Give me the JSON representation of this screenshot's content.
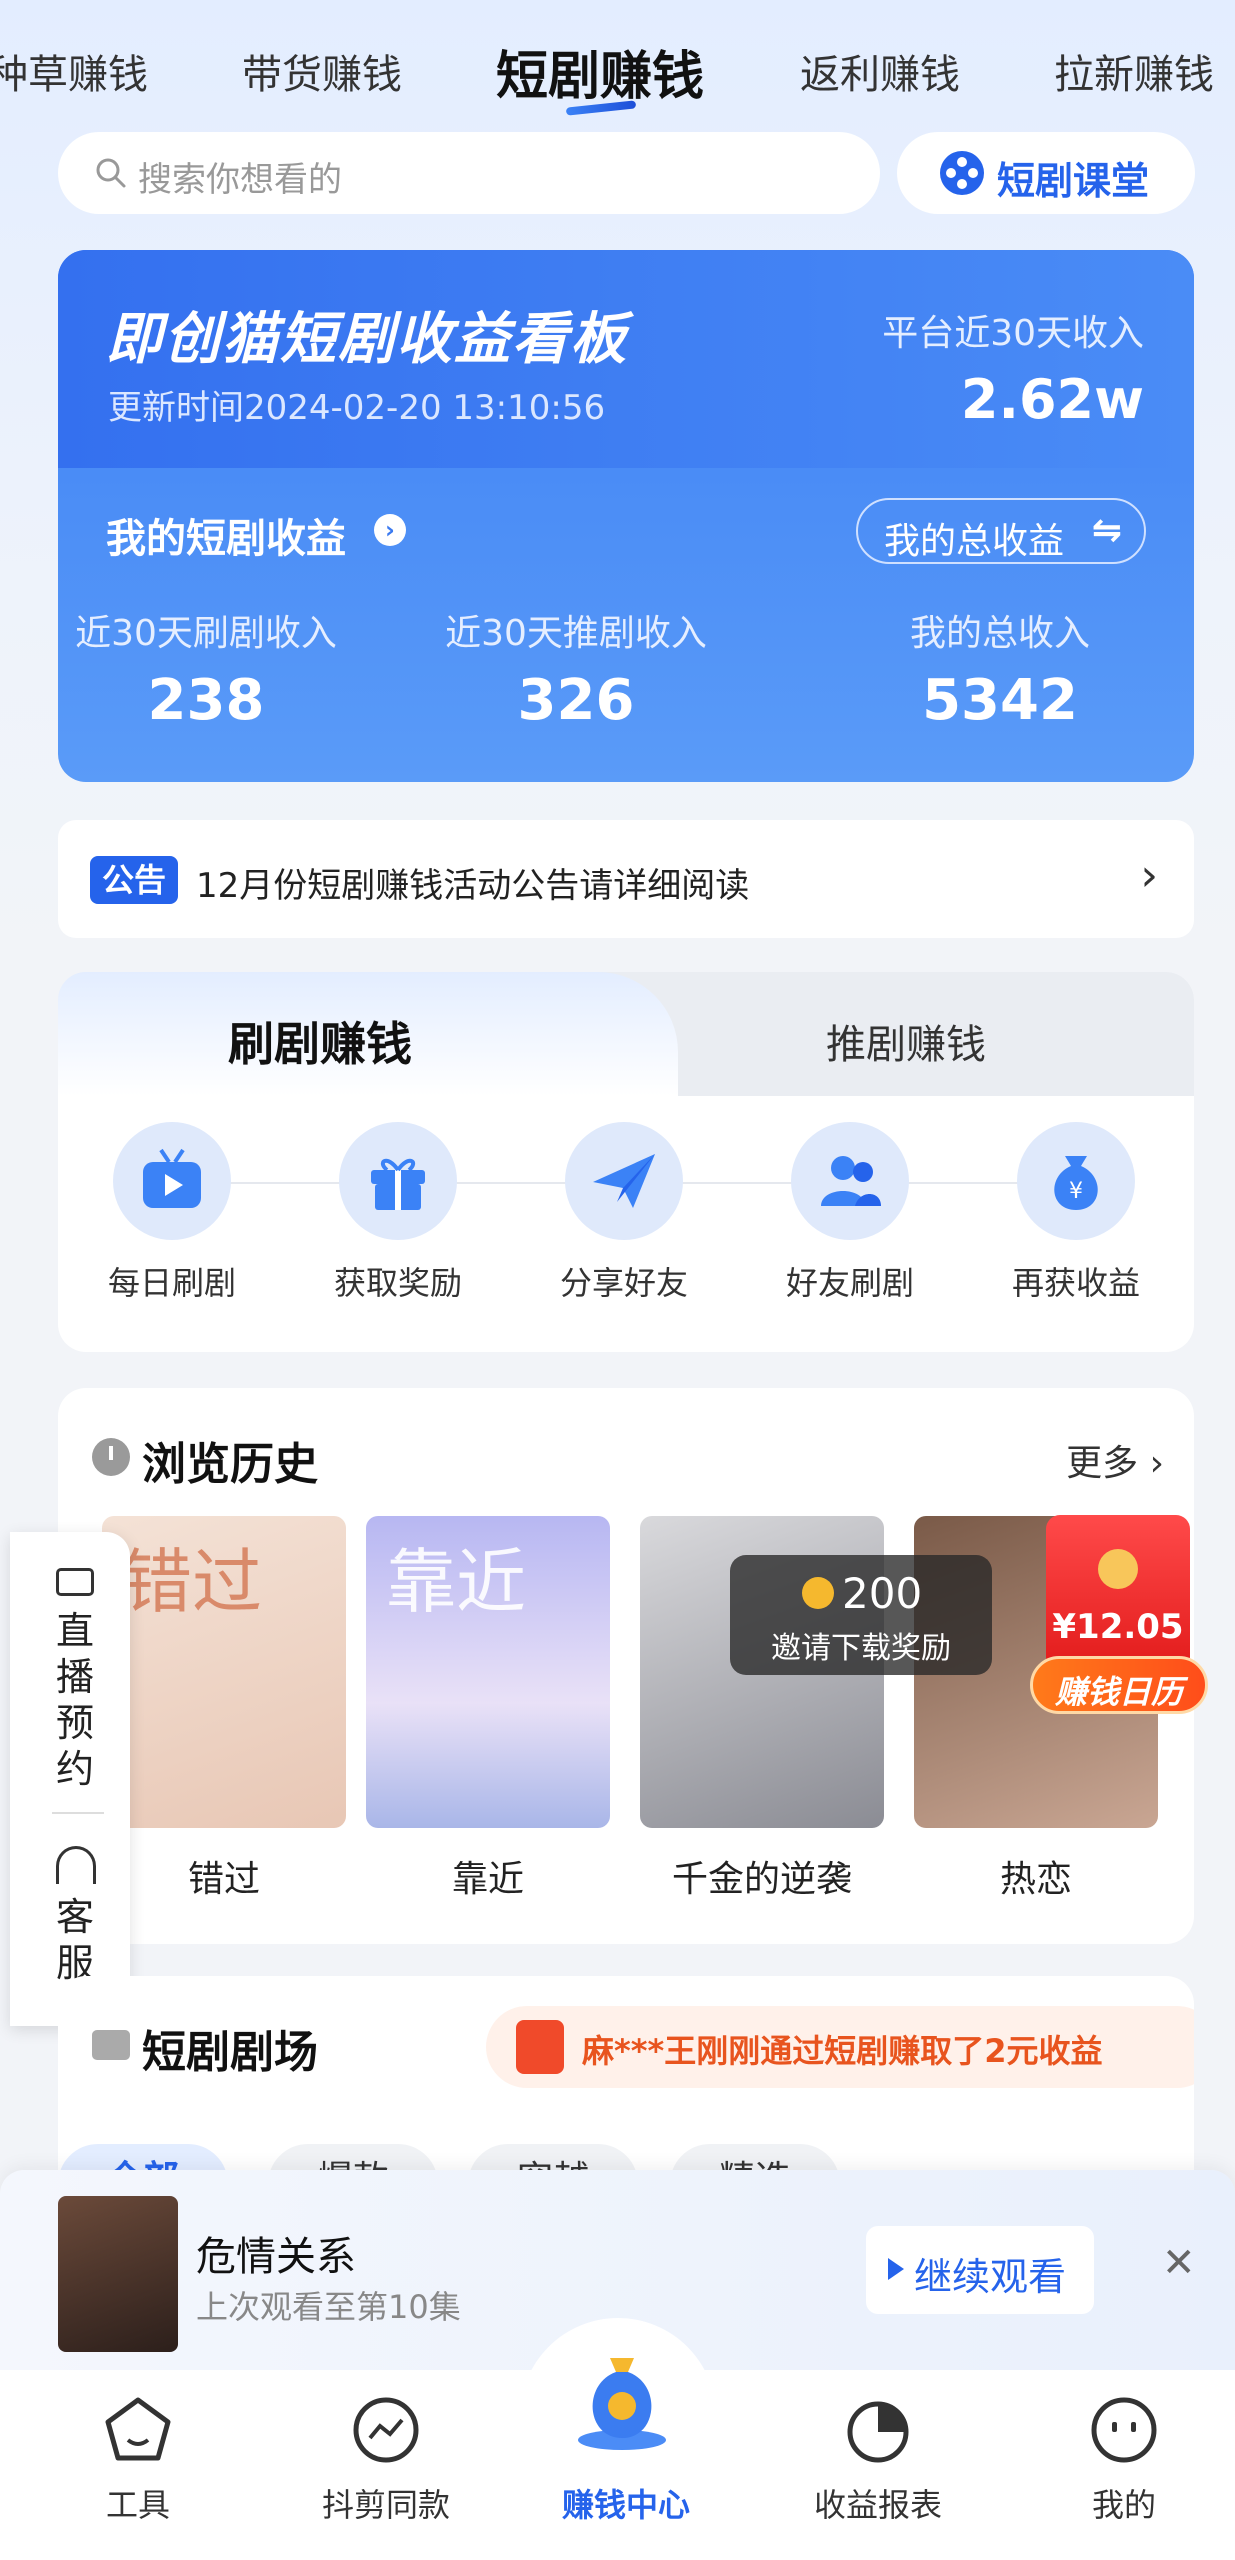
{
  "top_tabs": [
    "种草赚钱",
    "带货赚钱",
    "短剧赚钱",
    "返利赚钱",
    "拉新赚钱"
  ],
  "active_top_tab": "短剧赚钱",
  "search": {
    "placeholder": "搜索你想看的"
  },
  "course_button": {
    "label": "短剧课堂",
    "icon": "film-reel-icon"
  },
  "board": {
    "title": "即创猫短剧收益看板",
    "update_time": "更新时间2024-02-20 13:10:56",
    "platform_label": "平台近30天收入",
    "platform_value": "2.62w",
    "my_earnings_label": "我的短剧收益",
    "total_button": "我的总收益",
    "stats": [
      {
        "label": "近30天刷剧收入",
        "value": "238"
      },
      {
        "label": "近30天推剧收入",
        "value": "326"
      },
      {
        "label": "我的总收入",
        "value": "5342"
      }
    ]
  },
  "notice": {
    "badge": "公告",
    "text": "12月份短剧赚钱活动公告请详细阅读"
  },
  "earn_tabs": {
    "active": "刷剧赚钱",
    "inactive": "推剧赚钱"
  },
  "steps": [
    {
      "label": "每日刷剧",
      "icon": "tv-play-icon"
    },
    {
      "label": "获取奖励",
      "icon": "gift-icon"
    },
    {
      "label": "分享好友",
      "icon": "paper-plane-icon"
    },
    {
      "label": "好友刷剧",
      "icon": "friends-icon"
    },
    {
      "label": "再获收益",
      "icon": "money-bag-icon"
    }
  ],
  "history": {
    "title": "浏览历史",
    "more": "更多",
    "items": [
      {
        "title": "错过",
        "poster_word": "错过"
      },
      {
        "title": "靠近",
        "poster_word": "靠近"
      },
      {
        "title": "千金的逆袭",
        "poster_word": ""
      },
      {
        "title": "热恋",
        "poster_word": ""
      }
    ],
    "reward_tip": {
      "amount": "200",
      "label": "邀请下载奖励"
    },
    "red_packet": {
      "amount": "¥12.05",
      "tag": "赚钱日历"
    }
  },
  "side_panel": {
    "live": "直播预约",
    "service": "客服"
  },
  "theater": {
    "title": "短剧剧场",
    "ticker": "麻***王刚刚通过短剧赚取了2元收益",
    "chips": [
      "全部",
      "爆款",
      "穿越",
      "精选"
    ]
  },
  "continue_watching": {
    "name": "危情关系",
    "episode": "上次观看至第10集",
    "button": "继续观看"
  },
  "bottom_nav": [
    {
      "label": "工具",
      "icon": "home-pentagon-icon"
    },
    {
      "label": "抖剪同款",
      "icon": "trend-circle-icon"
    },
    {
      "label": "赚钱中心",
      "icon": "money-bag-icon"
    },
    {
      "label": "收益报表",
      "icon": "pie-chart-icon"
    },
    {
      "label": "我的",
      "icon": "smiley-face-icon"
    }
  ],
  "colors": {
    "accent": "#2563eb",
    "board": "#3d7cf1",
    "ticker": "#e8541e"
  }
}
